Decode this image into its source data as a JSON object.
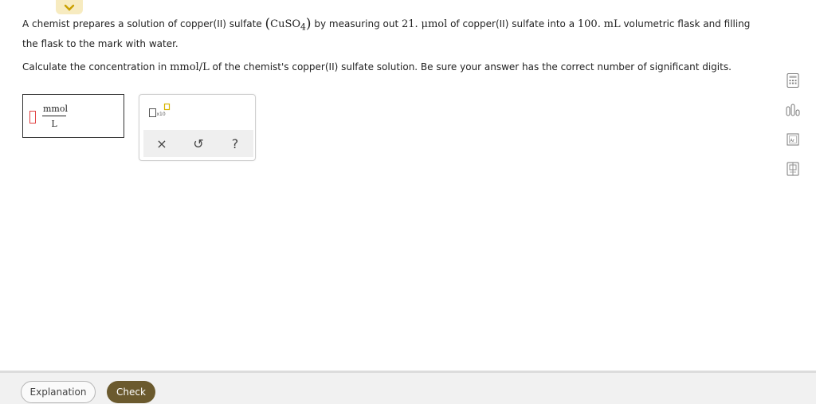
{
  "question": {
    "p1_a": "A chemist prepares a solution of copper(II) sulfate",
    "formula_main": "CuSO",
    "formula_sub": "4",
    "p1_b": "by measuring out",
    "amount": "21.",
    "amount_unit": "μmol",
    "p1_c": "of copper(II) sulfate into a",
    "volume": "100.",
    "volume_unit": "mL",
    "p1_d": "volumetric flask and filling the flask to the mark with water.",
    "p2_a": "Calculate the concentration in",
    "conc_unit": "mmol/L",
    "p2_b": "of the chemist's copper(II) sulfate solution. Be sure your answer has the correct number of significant digits."
  },
  "answer": {
    "unit_numerator": "mmol",
    "unit_denominator": "L",
    "value": ""
  },
  "toolpad": {
    "sci_label": "x10",
    "clear_symbol": "×",
    "undo_symbol": "↺",
    "help_symbol": "?"
  },
  "footer": {
    "explanation_label": "Explanation",
    "check_label": "Check"
  },
  "colors": {
    "check_bg": "#6b5a2e",
    "accent_yellow": "#f7ebc0",
    "input_red": "#e04040",
    "sci_box_yellow": "#d8b400"
  },
  "icons": [
    "chevron-down-icon",
    "scientific-notation-icon",
    "clear-icon",
    "undo-icon",
    "help-icon",
    "calculator-icon",
    "data-chart-icon",
    "periodic-table-icon",
    "reference-book-icon"
  ]
}
